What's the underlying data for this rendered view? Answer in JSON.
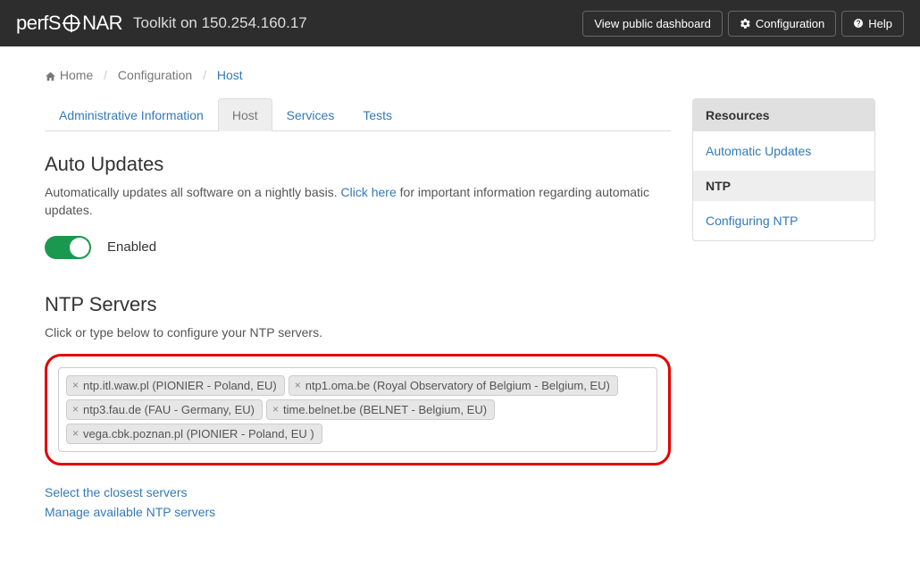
{
  "navbar": {
    "brand_perf": "perfS",
    "brand_nar": "NAR",
    "toolkit_label": "Toolkit on 150.254.160.17",
    "view_dashboard": "View public dashboard",
    "configuration": "Configuration",
    "help": "Help"
  },
  "breadcrumb": {
    "home": "Home",
    "config": "Configuration",
    "host": "Host"
  },
  "tabs": {
    "admin": "Administrative Information",
    "host": "Host",
    "services": "Services",
    "tests": "Tests"
  },
  "auto_updates": {
    "title": "Auto Updates",
    "desc_pre": "Automatically updates all software on a nightly basis. ",
    "click_here": "Click here",
    "desc_post": " for important information regarding automatic updates.",
    "enabled_label": "Enabled"
  },
  "ntp": {
    "title": "NTP Servers",
    "desc": "Click or type below to configure your NTP servers.",
    "servers": [
      "ntp.itl.waw.pl (PIONIER - Poland, EU)",
      "ntp1.oma.be (Royal Observatory of Belgium - Belgium, EU)",
      "ntp3.fau.de (FAU - Germany, EU)",
      "time.belnet.be (BELNET - Belgium, EU)",
      "vega.cbk.poznan.pl (PIONIER - Poland, EU )"
    ],
    "select_closest": "Select the closest servers",
    "manage": "Manage available NTP servers"
  },
  "resources": {
    "title": "Resources",
    "auto_updates": "Automatic Updates",
    "ntp_heading": "NTP",
    "configuring_ntp": "Configuring NTP"
  }
}
